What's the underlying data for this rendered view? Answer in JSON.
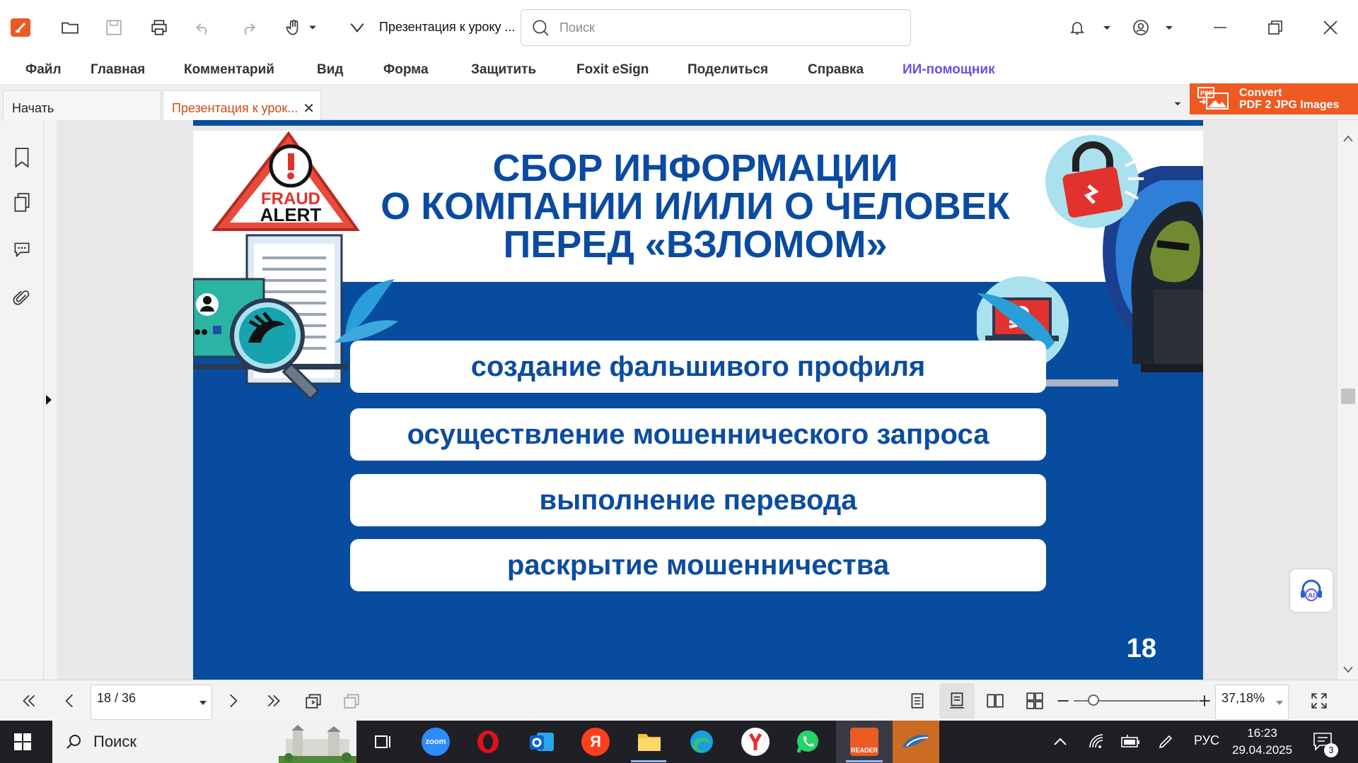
{
  "app": {
    "logo": "foxit-logo",
    "doc_title": "Презентация к уроку ...",
    "search_placeholder": "Поиск"
  },
  "menu": [
    "Файл",
    "Главная",
    "Комментарий",
    "Вид",
    "Форма",
    "Защитить",
    "Foxit eSign",
    "Поделиться",
    "Справка",
    "ИИ-помощник"
  ],
  "tabs": [
    {
      "label": "Начать",
      "active": false
    },
    {
      "label": "Презентация к урок...",
      "active": true
    }
  ],
  "ad": {
    "line1": "Convert",
    "line2": "PDF 2 JPG Images",
    "badge": "PDF"
  },
  "slide": {
    "title_lines": [
      "СБОР ИНФОРМАЦИИ",
      "О КОМПАНИИ И/ИЛИ О ЧЕЛОВЕК",
      "ПЕРЕД «ВЗЛОМОМ»"
    ],
    "fraud_alert": [
      "FRAUD",
      "ALERT"
    ],
    "items": [
      "создание фальшивого профиля",
      "осуществление мошеннического запроса",
      "выполнение перевода",
      "раскрытие мошенничества"
    ],
    "page_number": "18",
    "colors": {
      "primary": "#084ca0",
      "accent_red": "#e2322d",
      "light_blue": "#a9e1ee"
    }
  },
  "ai_float_label": "AI",
  "status": {
    "page_indicator": "18 / 36",
    "zoom": "37,18%"
  },
  "taskbar": {
    "search_label": "Поиск",
    "apps": [
      "task-view",
      "zoom",
      "opera",
      "outlook",
      "yandex",
      "explorer",
      "edge",
      "yandex-browser",
      "whatsapp",
      "foxit-reader",
      "app"
    ],
    "zoom_label": "zoom",
    "yandex_label": "Я",
    "reader_label": "READER",
    "lang": "РУС",
    "time": "16:23",
    "date": "29.04.2025",
    "notifications": "3"
  }
}
